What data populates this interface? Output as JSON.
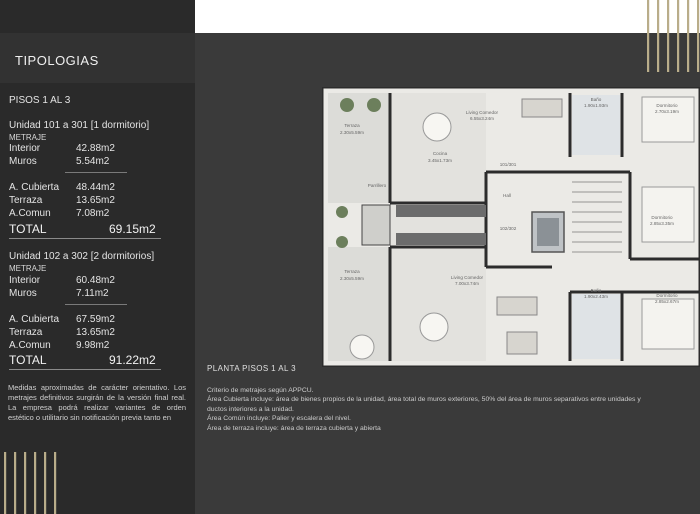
{
  "sidebar": {
    "title": "TIPOLOGIAS",
    "subtitle": "PISOS 1 AL 3",
    "units": [
      {
        "name": "Unidad 101 a 301",
        "type": "[1 dormitorio]",
        "metraje_label": "METRAJE",
        "interior_label": "Interior",
        "interior_value": "42.88m2",
        "muros_label": "Muros",
        "muros_value": "5.54m2",
        "cubierta_label": "A. Cubierta",
        "cubierta_value": "48.44m2",
        "terraza_label": "Terraza",
        "terraza_value": "13.65m2",
        "comun_label": "A.Comun",
        "comun_value": "7.08m2",
        "total_label": "TOTAL",
        "total_value": "69.15m2"
      },
      {
        "name": "Unidad 102 a 302",
        "type": "[2 dormitorios]",
        "metraje_label": "METRAJE",
        "interior_label": "Interior",
        "interior_value": "60.48m2",
        "muros_label": "Muros",
        "muros_value": "7.11m2",
        "cubierta_label": "A. Cubierta",
        "cubierta_value": "67.59m2",
        "terraza_label": "Terraza",
        "terraza_value": "13.65m2",
        "comun_label": "A.Comun",
        "comun_value": "9.98m2",
        "total_label": "TOTAL",
        "total_value": "91.22m2"
      }
    ],
    "disclaimer": "Medidas aproximadas de carácter orientativo. Los metrajes definitivos surgirán de la versión final real. La empresa podrá realizar variantes de orden estético o utilitario sin notificación previa tanto en"
  },
  "plan": {
    "caption": "PLANTA PISOS 1 AL 3",
    "rooms": {
      "terraza1_name": "Terraza",
      "terraza1_size": "2.30x5.59m",
      "cocina_name": "Cocina",
      "cocina_size": "3.45x1.73m",
      "living1_name": "Living Comedor",
      "living1_size": "6.55x3.24m",
      "bano1_name": "Baño",
      "bano1_size": "1.90x1.93m",
      "dorm1_name": "Dormitorio",
      "dorm1_size": "2.70x3.19m",
      "parrillero_name": "Parrillero",
      "unit_301_label": "101/301",
      "hall_name": "Hall",
      "unit_302_label": "102/302",
      "dorm2_name": "Dormitorio",
      "dorm2_size": "2.85x3.35m",
      "terraza2_name": "Terraza",
      "terraza2_size": "2.30x5.59m",
      "living2_name": "Living Comedor",
      "living2_size": "7.00x3.74m",
      "bano2_name": "Baño",
      "bano2_size": "1.90x2.43m",
      "dorm3_name": "Dormitorio",
      "dorm3_size": "2.85x2.67m"
    }
  },
  "notes": [
    "Criterio de metrajes según APPCU.",
    "Área Cubierta incluye: área de bienes propios de la unidad, área total de muros exteriores, 50% del área de muros separativos entre unidades y",
    "ductos interiores a la unidad.",
    "Área Común incluye: Palier y escalera del nivel.",
    "Área de terraza incluye: área de terraza cubierta y abierta"
  ],
  "colors": {
    "gold": "#b9ad8a",
    "sidebar_bg": "#2a2a2a",
    "page_bg": "#3a3a3a"
  }
}
